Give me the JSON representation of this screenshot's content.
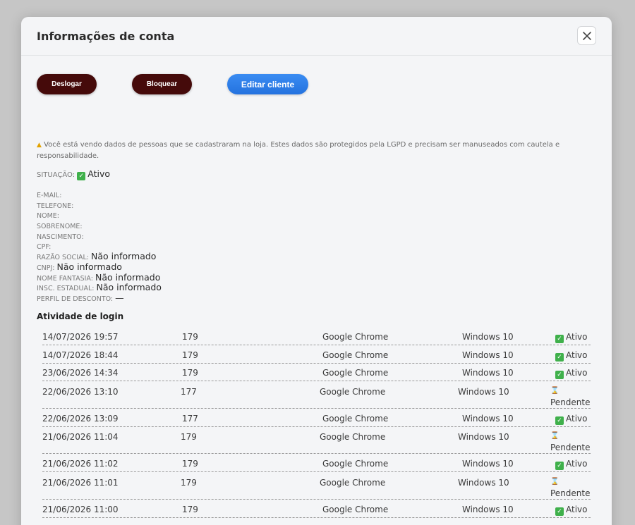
{
  "modal": {
    "title": "Informações de conta"
  },
  "actions": {
    "logout_label": "Deslogar",
    "block_label": "Bloquear",
    "edit_label": "Editar cliente"
  },
  "warning": {
    "icon": "warning-icon",
    "text": "Você está vendo dados de pessoas que se cadastraram na loja. Estes dados são protegidos pela LGPD e precisam ser manuseados com cautela e responsabilidade."
  },
  "situation": {
    "label": "SITUAÇÃO:",
    "value": "Ativo"
  },
  "fields": [
    {
      "label": "E-MAIL:",
      "value": ""
    },
    {
      "label": "TELEFONE:",
      "value": ""
    },
    {
      "label": "NOME:",
      "value": ""
    },
    {
      "label": "SOBRENOME:",
      "value": ""
    },
    {
      "label": "NASCIMENTO:",
      "value": ""
    },
    {
      "label": "CPF:",
      "value": ""
    },
    {
      "label": "RAZÃO SOCIAL:",
      "value": "Não informado"
    },
    {
      "label": "CNPJ:",
      "value": "Não informado"
    },
    {
      "label": "NOME FANTASIA:",
      "value": "Não informado"
    },
    {
      "label": "INSC. ESTADUAL:",
      "value": "Não informado"
    },
    {
      "label": "PERFIL DE DESCONTO:",
      "value": "—"
    }
  ],
  "login_activity": {
    "title": "Atividade de login",
    "rows": [
      {
        "date": "14/07/2026 19:57",
        "ip": "179",
        "browser": "Google Chrome",
        "os": "Windows 10",
        "status": "Ativo",
        "status_type": "active"
      },
      {
        "date": "14/07/2026 18:44",
        "ip": "179",
        "browser": "Google Chrome",
        "os": "Windows 10",
        "status": "Ativo",
        "status_type": "active"
      },
      {
        "date": "23/06/2026 14:34",
        "ip": "179",
        "browser": "Google Chrome",
        "os": "Windows 10",
        "status": "Ativo",
        "status_type": "active"
      },
      {
        "date": "22/06/2026 13:10",
        "ip": "177",
        "browser": "Google Chrome",
        "os": "Windows 10",
        "status": "Pendente",
        "status_type": "pending"
      },
      {
        "date": "22/06/2026 13:09",
        "ip": "177",
        "browser": "Google Chrome",
        "os": "Windows 10",
        "status": "Ativo",
        "status_type": "active"
      },
      {
        "date": "21/06/2026 11:04",
        "ip": "179",
        "browser": "Google Chrome",
        "os": "Windows 10",
        "status": "Pendente",
        "status_type": "pending"
      },
      {
        "date": "21/06/2026 11:02",
        "ip": "179",
        "browser": "Google Chrome",
        "os": "Windows 10",
        "status": "Ativo",
        "status_type": "active"
      },
      {
        "date": "21/06/2026 11:01",
        "ip": "179",
        "browser": "Google Chrome",
        "os": "Windows 10",
        "status": "Pendente",
        "status_type": "pending"
      },
      {
        "date": "21/06/2026 11:00",
        "ip": "179",
        "browser": "Google Chrome",
        "os": "Windows 10",
        "status": "Ativo",
        "status_type": "active"
      }
    ]
  },
  "colors": {
    "dark_button": "#450a0a",
    "primary_button": "#2a7be6",
    "active_check": "#3fb04b",
    "warning": "#e2a200"
  }
}
